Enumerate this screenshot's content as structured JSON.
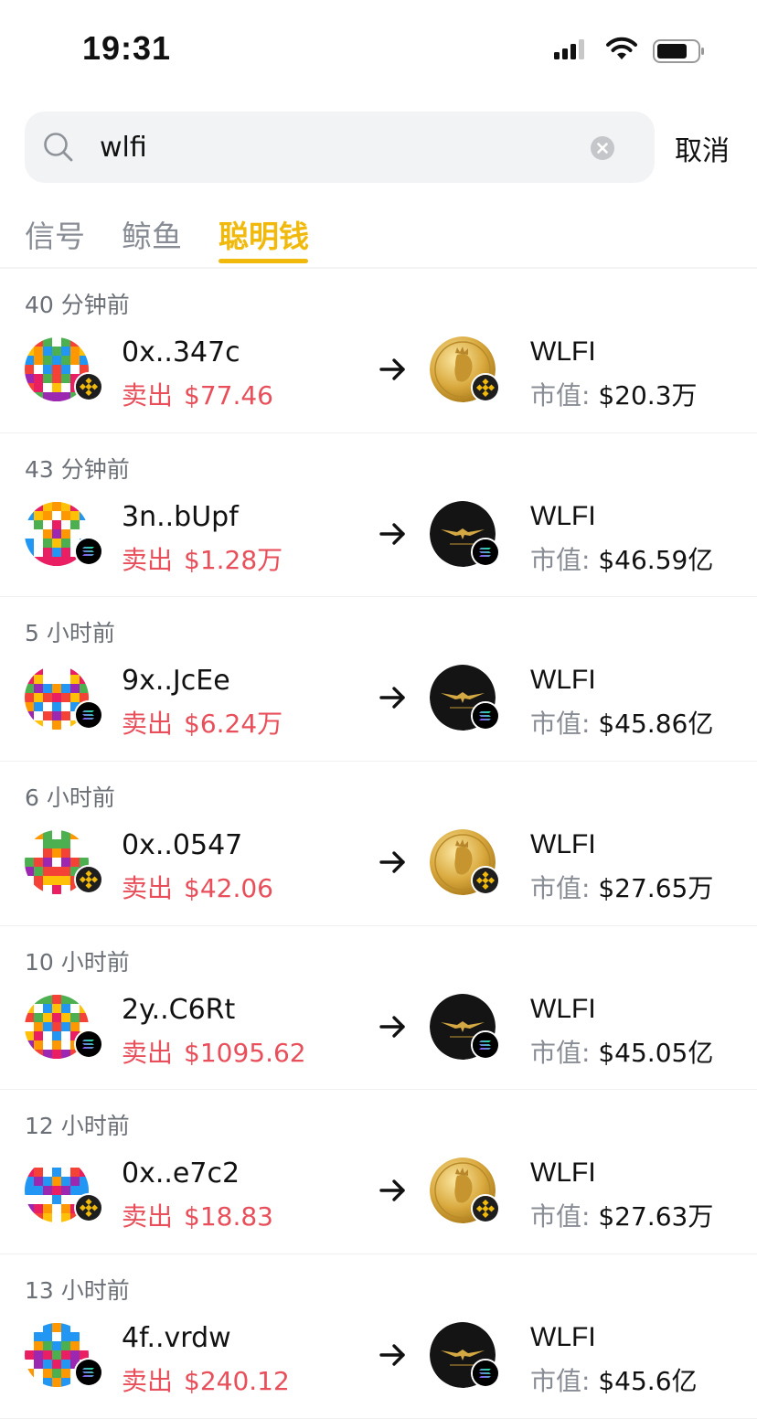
{
  "status_bar": {
    "time": "19:31"
  },
  "search": {
    "value": "wlfi",
    "cancel_label": "取消"
  },
  "tabs": [
    {
      "label": "信号",
      "active": false
    },
    {
      "label": "鲸鱼",
      "active": false
    },
    {
      "label": "聪明钱",
      "active": true
    }
  ],
  "colors": {
    "accent": "#f0b90b",
    "sell": "#e84f5a",
    "muted": "#888c94"
  },
  "transactions": [
    {
      "time": "40 分钟前",
      "wallet": "0x..347c",
      "action": "卖出",
      "amount": "$77.46",
      "chain": "bnb",
      "token": "WLFI",
      "token_logo": "gold-coin",
      "mcap_label": "市值:",
      "mcap": "$20.3万"
    },
    {
      "time": "43 分钟前",
      "wallet": "3n..bUpf",
      "action": "卖出",
      "amount": "$1.28万",
      "chain": "solana",
      "token": "WLFI",
      "token_logo": "eagle",
      "mcap_label": "市值:",
      "mcap": "$46.59亿"
    },
    {
      "time": "5 小时前",
      "wallet": "9x..JcEe",
      "action": "卖出",
      "amount": "$6.24万",
      "chain": "solana",
      "token": "WLFI",
      "token_logo": "eagle",
      "mcap_label": "市值:",
      "mcap": "$45.86亿"
    },
    {
      "time": "6 小时前",
      "wallet": "0x..0547",
      "action": "卖出",
      "amount": "$42.06",
      "chain": "bnb",
      "token": "WLFI",
      "token_logo": "gold-coin",
      "mcap_label": "市值:",
      "mcap": "$27.65万"
    },
    {
      "time": "10 小时前",
      "wallet": "2y..C6Rt",
      "action": "卖出",
      "amount": "$1095.62",
      "chain": "solana",
      "token": "WLFI",
      "token_logo": "eagle",
      "mcap_label": "市值:",
      "mcap": "$45.05亿"
    },
    {
      "time": "12 小时前",
      "wallet": "0x..e7c2",
      "action": "卖出",
      "amount": "$18.83",
      "chain": "bnb",
      "token": "WLFI",
      "token_logo": "gold-coin",
      "mcap_label": "市值:",
      "mcap": "$27.63万"
    },
    {
      "time": "13 小时前",
      "wallet": "4f..vrdw",
      "action": "卖出",
      "amount": "$240.12",
      "chain": "solana",
      "token": "WLFI",
      "token_logo": "eagle",
      "mcap_label": "市值:",
      "mcap": "$45.6亿"
    }
  ]
}
